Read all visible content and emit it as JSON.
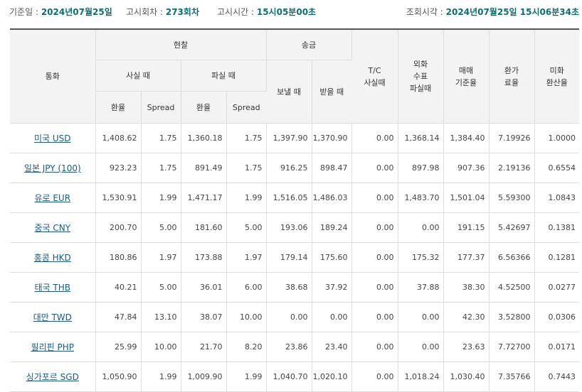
{
  "topbar": {
    "notice_date_label": "기준일 :",
    "notice_date": "2024년07월25일",
    "round_label": "고시회차 :",
    "round": "273회차",
    "time_label": "고시시간 :",
    "time": "15시05분00초",
    "query_label": "조회시각 :",
    "query_time": "2024년07월25일  15시06분34초"
  },
  "headers": {
    "currency": "통화",
    "cash": "현찰",
    "wire": "송금",
    "cash_buy": "사실 때",
    "cash_sell": "파실 때",
    "wire_send": "보낼 때",
    "wire_receive": "받을 때",
    "tc_buy": "T/C\n사실때",
    "fx_check": "외화\n수표\n파실때",
    "base_rate": "매매\n기준율",
    "conv_rate": "환가\n료율",
    "usd_conv": "미화\n환산율",
    "rate": "환율",
    "spread": "Spread"
  },
  "rows": [
    {
      "currency": "미국 USD",
      "cash_buy_rate": "1,408.62",
      "cash_buy_spread": "1.75",
      "cash_sell_rate": "1,360.18",
      "cash_sell_spread": "1.75",
      "send": "1,397.90",
      "receive": "1,370.90",
      "tc": "0.00",
      "check": "1,368.14",
      "base": "1,384.40",
      "conv": "7.19926",
      "usd": "1.0000"
    },
    {
      "currency": "일본 JPY (100)",
      "cash_buy_rate": "923.23",
      "cash_buy_spread": "1.75",
      "cash_sell_rate": "891.49",
      "cash_sell_spread": "1.75",
      "send": "916.25",
      "receive": "898.47",
      "tc": "0.00",
      "check": "897.98",
      "base": "907.36",
      "conv": "2.19136",
      "usd": "0.6554"
    },
    {
      "currency": "유로 EUR",
      "cash_buy_rate": "1,530.91",
      "cash_buy_spread": "1.99",
      "cash_sell_rate": "1,471.17",
      "cash_sell_spread": "1.99",
      "send": "1,516.05",
      "receive": "1,486.03",
      "tc": "0.00",
      "check": "1,483.70",
      "base": "1,501.04",
      "conv": "5.59300",
      "usd": "1.0843"
    },
    {
      "currency": "중국 CNY",
      "cash_buy_rate": "200.70",
      "cash_buy_spread": "5.00",
      "cash_sell_rate": "181.60",
      "cash_sell_spread": "5.00",
      "send": "193.06",
      "receive": "189.24",
      "tc": "0.00",
      "check": "0.00",
      "base": "191.15",
      "conv": "5.42697",
      "usd": "0.1381"
    },
    {
      "currency": "홍콩 HKD",
      "cash_buy_rate": "180.86",
      "cash_buy_spread": "1.97",
      "cash_sell_rate": "173.88",
      "cash_sell_spread": "1.97",
      "send": "179.14",
      "receive": "175.60",
      "tc": "0.00",
      "check": "175.32",
      "base": "177.37",
      "conv": "6.56366",
      "usd": "0.1281"
    },
    {
      "currency": "태국 THB",
      "cash_buy_rate": "40.21",
      "cash_buy_spread": "5.00",
      "cash_sell_rate": "36.01",
      "cash_sell_spread": "6.00",
      "send": "38.68",
      "receive": "37.92",
      "tc": "0.00",
      "check": "37.88",
      "base": "38.30",
      "conv": "4.52500",
      "usd": "0.0277"
    },
    {
      "currency": "대만 TWD",
      "cash_buy_rate": "47.84",
      "cash_buy_spread": "13.10",
      "cash_sell_rate": "38.07",
      "cash_sell_spread": "10.00",
      "send": "0.00",
      "receive": "0.00",
      "tc": "0.00",
      "check": "0.00",
      "base": "42.30",
      "conv": "3.52800",
      "usd": "0.0306"
    },
    {
      "currency": "필리핀 PHP",
      "cash_buy_rate": "25.99",
      "cash_buy_spread": "10.00",
      "cash_sell_rate": "21.70",
      "cash_sell_spread": "8.20",
      "send": "23.86",
      "receive": "23.40",
      "tc": "0.00",
      "check": "0.00",
      "base": "23.63",
      "conv": "7.72700",
      "usd": "0.0171"
    },
    {
      "currency": "싱가포르 SGD",
      "cash_buy_rate": "1,050.90",
      "cash_buy_spread": "1.99",
      "cash_sell_rate": "1,009.90",
      "cash_sell_spread": "1.99",
      "send": "1,040.70",
      "receive": "1,020.10",
      "tc": "0.00",
      "check": "1,018.24",
      "base": "1,030.40",
      "conv": "7.35766",
      "usd": "0.7443"
    }
  ]
}
